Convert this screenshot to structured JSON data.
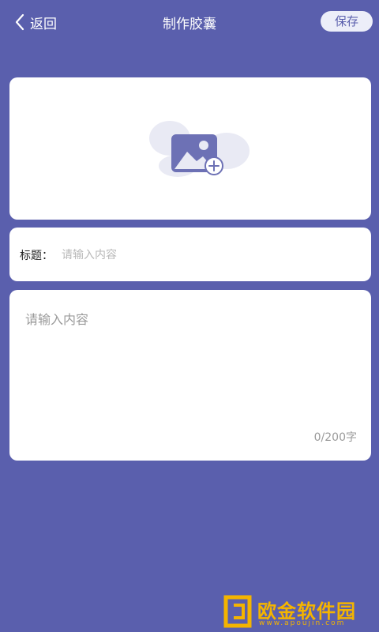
{
  "header": {
    "back_label": "返回",
    "title": "制作胶囊",
    "save_label": "保存"
  },
  "image_upload": {
    "icon": "add-image-icon"
  },
  "title_field": {
    "label": "标题：",
    "placeholder": "请输入内容",
    "value": ""
  },
  "content_field": {
    "placeholder": "请输入内容",
    "value": "",
    "counter": "0/200字"
  },
  "watermark": {
    "text": "欧金软件园",
    "url": "www.apoujin.com"
  },
  "colors": {
    "background": "#5a5fad",
    "card": "#ffffff",
    "accent": "#5a5fad",
    "watermark": "#f4b400"
  }
}
